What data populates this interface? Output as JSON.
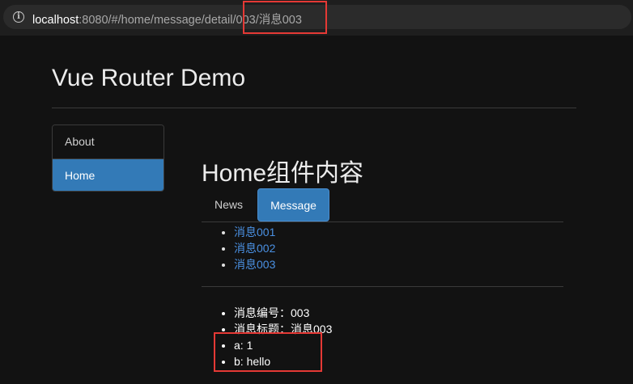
{
  "browser": {
    "url_host": "localhost",
    "url_path": ":8080/#/home/message/detail/003/消息003",
    "info_icon": "i"
  },
  "header": {
    "title": "Vue Router Demo"
  },
  "sidebar": {
    "items": [
      {
        "label": "About"
      },
      {
        "label": "Home"
      }
    ]
  },
  "main": {
    "heading": "Home组件内容",
    "tabs": [
      {
        "label": "News"
      },
      {
        "label": "Message"
      }
    ],
    "messages": [
      {
        "label": "消息001"
      },
      {
        "label": "消息002"
      },
      {
        "label": "消息003"
      }
    ],
    "details": [
      {
        "text": "消息编号：003"
      },
      {
        "text": "消息标题：消息003"
      },
      {
        "text": "a: 1"
      },
      {
        "text": "b: hello"
      }
    ]
  },
  "colors": {
    "active": "#337ab7",
    "link": "#4a90e2",
    "highlight": "#e53935"
  }
}
